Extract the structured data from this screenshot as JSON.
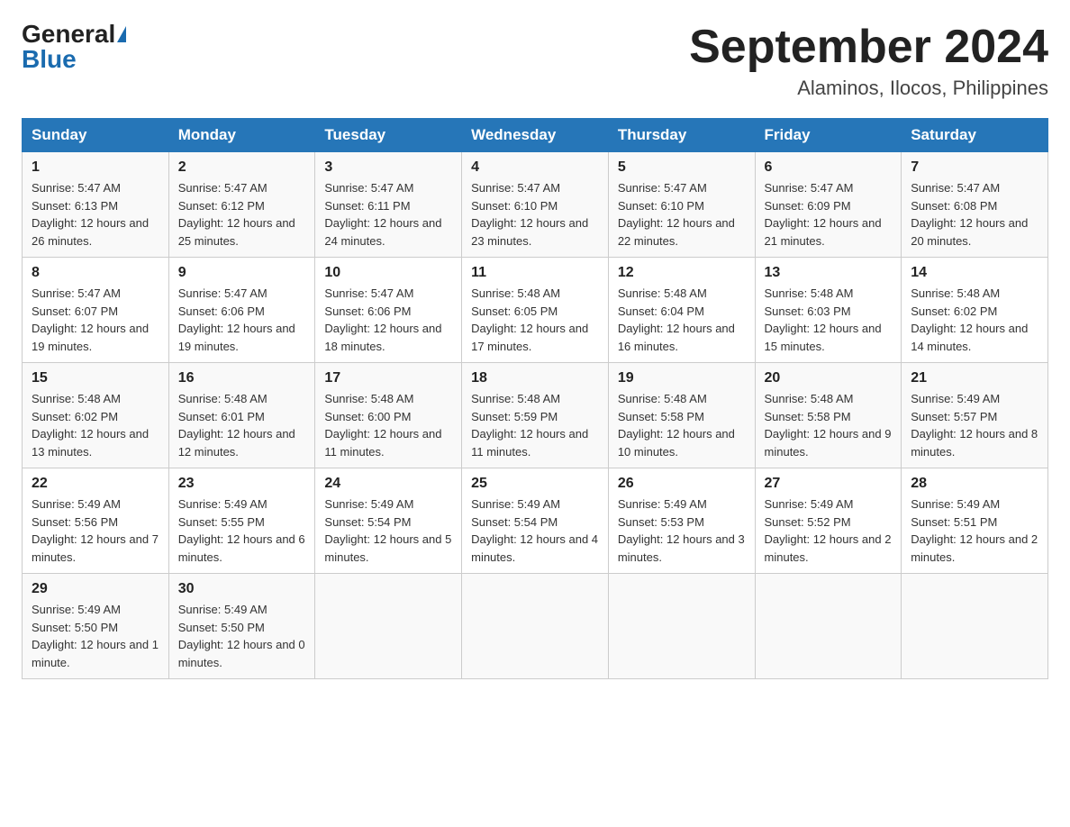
{
  "header": {
    "logo_general": "General",
    "logo_blue": "Blue",
    "month_title": "September 2024",
    "location": "Alaminos, Ilocos, Philippines"
  },
  "weekdays": [
    "Sunday",
    "Monday",
    "Tuesday",
    "Wednesday",
    "Thursday",
    "Friday",
    "Saturday"
  ],
  "weeks": [
    [
      {
        "day": "1",
        "sunrise": "5:47 AM",
        "sunset": "6:13 PM",
        "daylight": "12 hours and 26 minutes."
      },
      {
        "day": "2",
        "sunrise": "5:47 AM",
        "sunset": "6:12 PM",
        "daylight": "12 hours and 25 minutes."
      },
      {
        "day": "3",
        "sunrise": "5:47 AM",
        "sunset": "6:11 PM",
        "daylight": "12 hours and 24 minutes."
      },
      {
        "day": "4",
        "sunrise": "5:47 AM",
        "sunset": "6:10 PM",
        "daylight": "12 hours and 23 minutes."
      },
      {
        "day": "5",
        "sunrise": "5:47 AM",
        "sunset": "6:10 PM",
        "daylight": "12 hours and 22 minutes."
      },
      {
        "day": "6",
        "sunrise": "5:47 AM",
        "sunset": "6:09 PM",
        "daylight": "12 hours and 21 minutes."
      },
      {
        "day": "7",
        "sunrise": "5:47 AM",
        "sunset": "6:08 PM",
        "daylight": "12 hours and 20 minutes."
      }
    ],
    [
      {
        "day": "8",
        "sunrise": "5:47 AM",
        "sunset": "6:07 PM",
        "daylight": "12 hours and 19 minutes."
      },
      {
        "day": "9",
        "sunrise": "5:47 AM",
        "sunset": "6:06 PM",
        "daylight": "12 hours and 19 minutes."
      },
      {
        "day": "10",
        "sunrise": "5:47 AM",
        "sunset": "6:06 PM",
        "daylight": "12 hours and 18 minutes."
      },
      {
        "day": "11",
        "sunrise": "5:48 AM",
        "sunset": "6:05 PM",
        "daylight": "12 hours and 17 minutes."
      },
      {
        "day": "12",
        "sunrise": "5:48 AM",
        "sunset": "6:04 PM",
        "daylight": "12 hours and 16 minutes."
      },
      {
        "day": "13",
        "sunrise": "5:48 AM",
        "sunset": "6:03 PM",
        "daylight": "12 hours and 15 minutes."
      },
      {
        "day": "14",
        "sunrise": "5:48 AM",
        "sunset": "6:02 PM",
        "daylight": "12 hours and 14 minutes."
      }
    ],
    [
      {
        "day": "15",
        "sunrise": "5:48 AM",
        "sunset": "6:02 PM",
        "daylight": "12 hours and 13 minutes."
      },
      {
        "day": "16",
        "sunrise": "5:48 AM",
        "sunset": "6:01 PM",
        "daylight": "12 hours and 12 minutes."
      },
      {
        "day": "17",
        "sunrise": "5:48 AM",
        "sunset": "6:00 PM",
        "daylight": "12 hours and 11 minutes."
      },
      {
        "day": "18",
        "sunrise": "5:48 AM",
        "sunset": "5:59 PM",
        "daylight": "12 hours and 11 minutes."
      },
      {
        "day": "19",
        "sunrise": "5:48 AM",
        "sunset": "5:58 PM",
        "daylight": "12 hours and 10 minutes."
      },
      {
        "day": "20",
        "sunrise": "5:48 AM",
        "sunset": "5:58 PM",
        "daylight": "12 hours and 9 minutes."
      },
      {
        "day": "21",
        "sunrise": "5:49 AM",
        "sunset": "5:57 PM",
        "daylight": "12 hours and 8 minutes."
      }
    ],
    [
      {
        "day": "22",
        "sunrise": "5:49 AM",
        "sunset": "5:56 PM",
        "daylight": "12 hours and 7 minutes."
      },
      {
        "day": "23",
        "sunrise": "5:49 AM",
        "sunset": "5:55 PM",
        "daylight": "12 hours and 6 minutes."
      },
      {
        "day": "24",
        "sunrise": "5:49 AM",
        "sunset": "5:54 PM",
        "daylight": "12 hours and 5 minutes."
      },
      {
        "day": "25",
        "sunrise": "5:49 AM",
        "sunset": "5:54 PM",
        "daylight": "12 hours and 4 minutes."
      },
      {
        "day": "26",
        "sunrise": "5:49 AM",
        "sunset": "5:53 PM",
        "daylight": "12 hours and 3 minutes."
      },
      {
        "day": "27",
        "sunrise": "5:49 AM",
        "sunset": "5:52 PM",
        "daylight": "12 hours and 2 minutes."
      },
      {
        "day": "28",
        "sunrise": "5:49 AM",
        "sunset": "5:51 PM",
        "daylight": "12 hours and 2 minutes."
      }
    ],
    [
      {
        "day": "29",
        "sunrise": "5:49 AM",
        "sunset": "5:50 PM",
        "daylight": "12 hours and 1 minute."
      },
      {
        "day": "30",
        "sunrise": "5:49 AM",
        "sunset": "5:50 PM",
        "daylight": "12 hours and 0 minutes."
      },
      null,
      null,
      null,
      null,
      null
    ]
  ],
  "labels": {
    "sunrise": "Sunrise:",
    "sunset": "Sunset:",
    "daylight": "Daylight:"
  }
}
